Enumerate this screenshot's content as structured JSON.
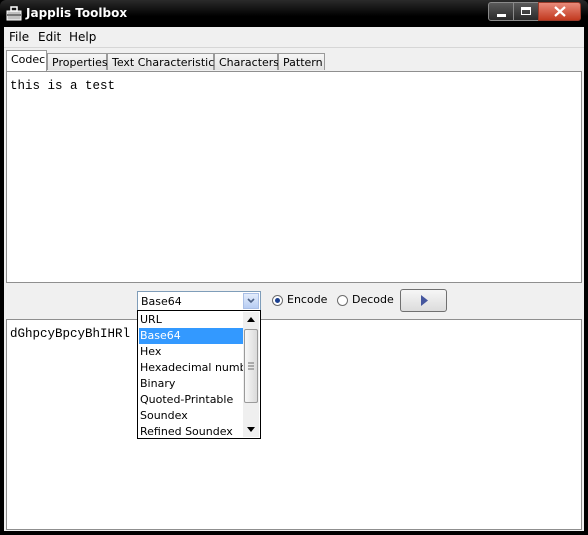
{
  "window": {
    "title": "Japplis Toolbox",
    "accent": "#3399ff"
  },
  "menu": {
    "file": "File",
    "edit": "Edit",
    "help": "Help"
  },
  "tabs": [
    "Codec",
    "Properties",
    "Text Characteristics",
    "Characters",
    "Pattern"
  ],
  "input_text": "this is a test",
  "output_text": "dGhpcyBpcyBhIHRl",
  "codec": {
    "selected": "Base64",
    "options": [
      "URL",
      "Base64",
      "Hex",
      "Hexadecimal number",
      "Binary",
      "Quoted-Printable",
      "Soundex",
      "Refined Soundex"
    ],
    "encode_label": "Encode",
    "decode_label": "Decode",
    "mode": "Encode"
  },
  "icons": {
    "app": "toolbox-icon",
    "minimize": "minimize-icon",
    "maximize": "maximize-icon",
    "close": "close-icon",
    "run": "play-arrow-icon",
    "combo": "chevron-down-icon"
  }
}
